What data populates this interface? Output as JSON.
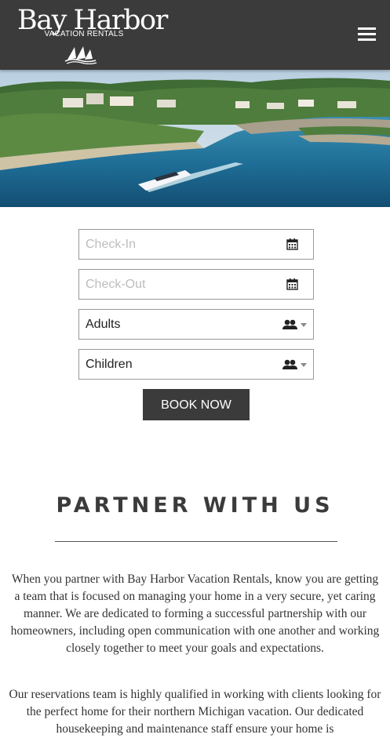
{
  "header": {
    "logo_main": "Bay Harbor",
    "logo_sub": "VACATION RENTALS"
  },
  "booking": {
    "checkin_placeholder": "Check-In",
    "checkout_placeholder": "Check-Out",
    "adults_label": "Adults",
    "children_label": "Children",
    "book_label": "BOOK NOW"
  },
  "partner": {
    "title": "PARTNER WITH US",
    "paragraph1": "When you partner with Bay Harbor Vacation Rentals, know you are getting a team that is focused on managing your home in a very secure, yet caring manner.  We are dedicated to forming a successful partnership with our homeowners, including open communication with one another and working closely together to meet your goals and expectations.",
    "paragraph2": "Our reservations team is highly qualified in working with clients looking for the perfect home for their northern Michigan vacation. Our dedicated housekeeping and maintenance staff ensure your home is"
  },
  "colors": {
    "header_bg": "#3b3b3b",
    "button_bg": "#3b3b3b",
    "title_color": "#3b3b3b"
  }
}
